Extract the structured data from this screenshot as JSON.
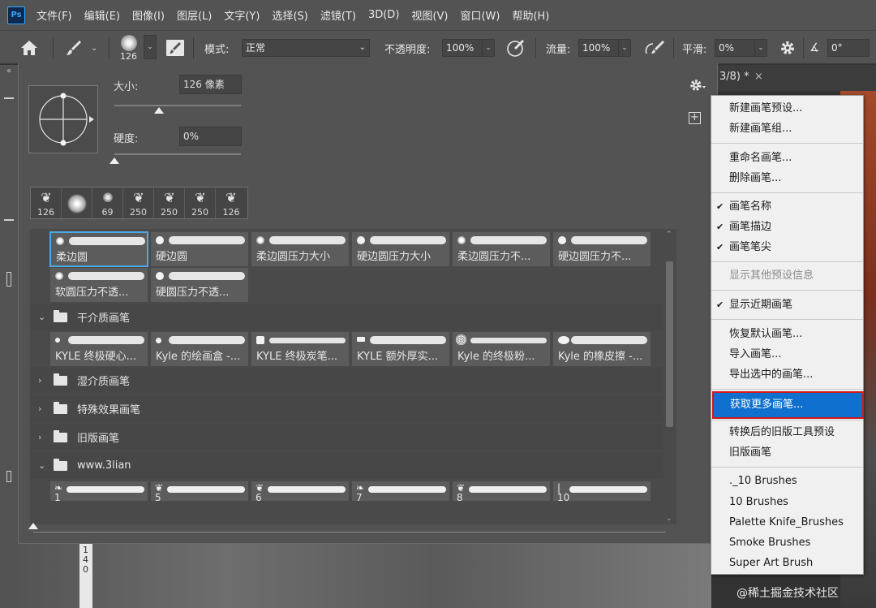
{
  "menubar": {
    "logo": "Ps",
    "items": [
      "文件(F)",
      "编辑(E)",
      "图像(I)",
      "图层(L)",
      "文字(Y)",
      "选择(S)",
      "滤镜(T)",
      "3D(D)",
      "视图(V)",
      "窗口(W)",
      "帮助(H)"
    ]
  },
  "options": {
    "brush_size": "126",
    "mode_label": "模式:",
    "mode_value": "正常",
    "opacity_label": "不透明度:",
    "opacity_value": "100%",
    "flow_label": "流量:",
    "flow_value": "100%",
    "smooth_label": "平滑:",
    "smooth_value": "0%",
    "angle_value": "0°",
    "collapse_glyph": "«"
  },
  "doc_tab": {
    "label": "3/8) *",
    "close": "×"
  },
  "brush_panel": {
    "size_label": "大小:",
    "size_value": "126 像素",
    "size_fraction": 0.35,
    "hardness_label": "硬度:",
    "hardness_value": "0%",
    "hardness_fraction": 0.0,
    "recent": [
      {
        "glyph": "❦",
        "size": "126"
      },
      {
        "glyph": "●",
        "size": ""
      },
      {
        "glyph": "✺",
        "size": "69"
      },
      {
        "glyph": "❦",
        "size": "250"
      },
      {
        "glyph": "❦",
        "size": "250"
      },
      {
        "glyph": "❦",
        "size": "250"
      },
      {
        "glyph": "❦",
        "size": "126"
      }
    ],
    "general_row1": [
      "柔边圆",
      "硬边圆",
      "柔边圆压力大小",
      "硬边圆压力大小",
      "柔边圆压力不...",
      "硬边圆压力不..."
    ],
    "general_row2": [
      "软圆压力不透...",
      "硬圆压力不透..."
    ],
    "groups": {
      "dry": {
        "name": "干介质画笔",
        "chevron": "⌄",
        "items": [
          "KYLE 终极硬心...",
          "Kyle 的绘画盒 -...",
          "KYLE 终极炭笔...",
          "KYLE 额外厚实...",
          "Kyle 的终极粉...",
          "Kyle 的橡皮擦 -..."
        ]
      },
      "wet": {
        "name": "湿介质画笔",
        "chevron": "›"
      },
      "special": {
        "name": "特殊效果画笔",
        "chevron": "›"
      },
      "legacy": {
        "name": "旧版画笔",
        "chevron": "›"
      },
      "www": {
        "name": "www.3lian",
        "chevron": "⌄",
        "items": [
          "1",
          "5",
          "6",
          "7",
          "8",
          "10"
        ]
      }
    },
    "bottom_slider_fraction": 0.0
  },
  "context_menu": {
    "items": [
      {
        "label": "新建画笔预设...",
        "checked": false,
        "disabled": false
      },
      {
        "label": "新建画笔组...",
        "checked": false,
        "disabled": false
      },
      {
        "label": "重命名画笔...",
        "checked": false,
        "disabled": false
      },
      {
        "label": "删除画笔...",
        "checked": false,
        "disabled": false
      },
      {
        "label": "画笔名称",
        "checked": true,
        "disabled": false
      },
      {
        "label": "画笔描边",
        "checked": true,
        "disabled": false
      },
      {
        "label": "画笔笔尖",
        "checked": true,
        "disabled": false
      },
      {
        "label": "显示其他预设信息",
        "checked": false,
        "disabled": true
      },
      {
        "label": "显示近期画笔",
        "checked": true,
        "disabled": false
      },
      {
        "label": "恢复默认画笔...",
        "checked": false,
        "disabled": false
      },
      {
        "label": "导入画笔...",
        "checked": false,
        "disabled": false
      },
      {
        "label": "导出选中的画笔...",
        "checked": false,
        "disabled": false
      },
      {
        "label": "获取更多画笔...",
        "checked": false,
        "disabled": false,
        "highlighted": true
      },
      {
        "label": "转换后的旧版工具预设",
        "checked": false,
        "disabled": false
      },
      {
        "label": "旧版画笔",
        "checked": false,
        "disabled": false
      },
      {
        "label": "._10 Brushes",
        "checked": false,
        "disabled": false
      },
      {
        "label": "10 Brushes",
        "checked": false,
        "disabled": false
      },
      {
        "label": "Palette Knife_Brushes",
        "checked": false,
        "disabled": false
      },
      {
        "label": "Smoke Brushes",
        "checked": false,
        "disabled": false
      },
      {
        "label": "Super Art Brush",
        "checked": false,
        "disabled": false
      }
    ],
    "check_glyph": "✔"
  },
  "ruler_digits": [
    "1",
    "4",
    "0"
  ],
  "watermark": "@稀土掘金技术社区",
  "colors": {
    "accent_selection": "#0f70cf",
    "highlight_border": "#d41818",
    "thumb_selected": "#4ea8e5"
  }
}
